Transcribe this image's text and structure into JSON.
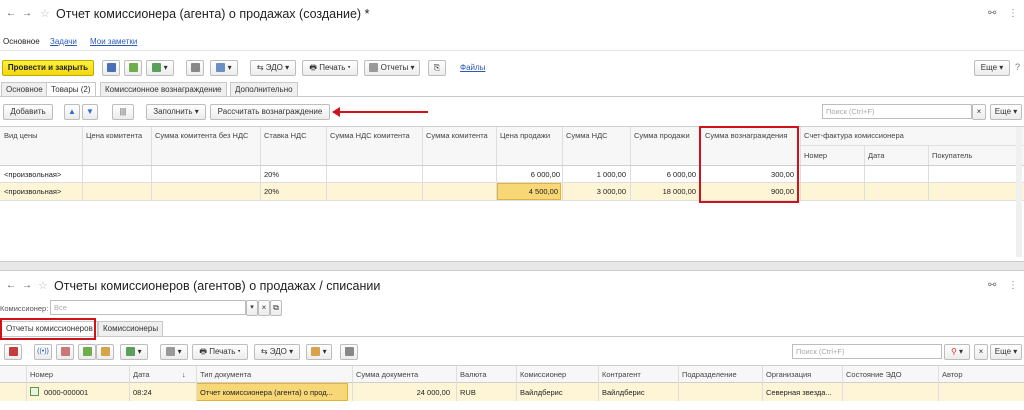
{
  "win1": {
    "title": "Отчет комиссионера (агента) о продажах (создание) *",
    "sections": [
      "Основное",
      "Задачи",
      "Мои заметки"
    ],
    "toolbar": {
      "post_close": "Провести и закрыть",
      "edo": "ЭДО",
      "print": "Печать",
      "reports": "Отчеты",
      "files": "Файлы",
      "more": "Еще"
    },
    "tabs": [
      "Основное",
      "Товары (2)",
      "Комиссионное вознаграждение",
      "Дополнительно"
    ],
    "table_toolbar": {
      "add": "Добавить",
      "fill": "Заполнить",
      "calc": "Рассчитать вознаграждение",
      "search_placeholder": "Поиск (Ctrl+F)",
      "clear": "×",
      "more": "Еще"
    },
    "columns": [
      "Вид цены",
      "Цена комитента",
      "Сумма комитента без НДС",
      "Ставка НДС",
      "Сумма НДС комитента",
      "Сумма комитента",
      "Цена продажи",
      "Сумма НДС",
      "Сумма продажи",
      "Сумма вознаграждения",
      "Счет-фактура комиссионера"
    ],
    "subcolumns": [
      "Номер",
      "Дата",
      "Покупатель"
    ],
    "rows": [
      {
        "price_type": "<произвольная>",
        "vat_rate": "20%",
        "sale_price": "6 000,00",
        "vat_sum": "1 000,00",
        "sale_sum": "6 000,00",
        "reward": "300,00"
      },
      {
        "price_type": "<произвольная>",
        "vat_rate": "20%",
        "sale_price": "4 500,00",
        "vat_sum": "3 000,00",
        "sale_sum": "18 000,00",
        "reward": "900,00"
      }
    ]
  },
  "win2": {
    "title": "Отчеты комиссионеров (агентов) о продажах / списании",
    "filter_label": "Комиссионер:",
    "filter_placeholder": "Все",
    "tabs": [
      "Отчеты комиссионеров",
      "Комиссионеры"
    ],
    "toolbar": {
      "print": "Печать",
      "edo": "ЭДО",
      "search_placeholder": "Поиск (Ctrl+F)",
      "more": "Еще"
    },
    "columns": [
      "Номер",
      "Дата",
      "Тип документа",
      "Сумма документа",
      "Валюта",
      "Комиссионер",
      "Контрагент",
      "Подразделение",
      "Организация",
      "Состояние ЭДО",
      "Автор"
    ],
    "sort_indicator": "↓",
    "rows": [
      {
        "number": "0000-000001",
        "time": "08:24",
        "doc_type": "Отчет комиссионера (агента) о прод...",
        "sum": "24 000,00",
        "currency": "RUB",
        "commissioner": "Вайлдберис",
        "counterparty": "Вайлдберис",
        "department": "",
        "org": "Северная звезда...",
        "edo_state": "",
        "author": ""
      }
    ]
  },
  "colors": {
    "accent_yellow": "#f2d60f",
    "highlight_red": "#d0121b",
    "row_highlight": "#fdf5d6",
    "selected_cell": "#f8d776"
  }
}
